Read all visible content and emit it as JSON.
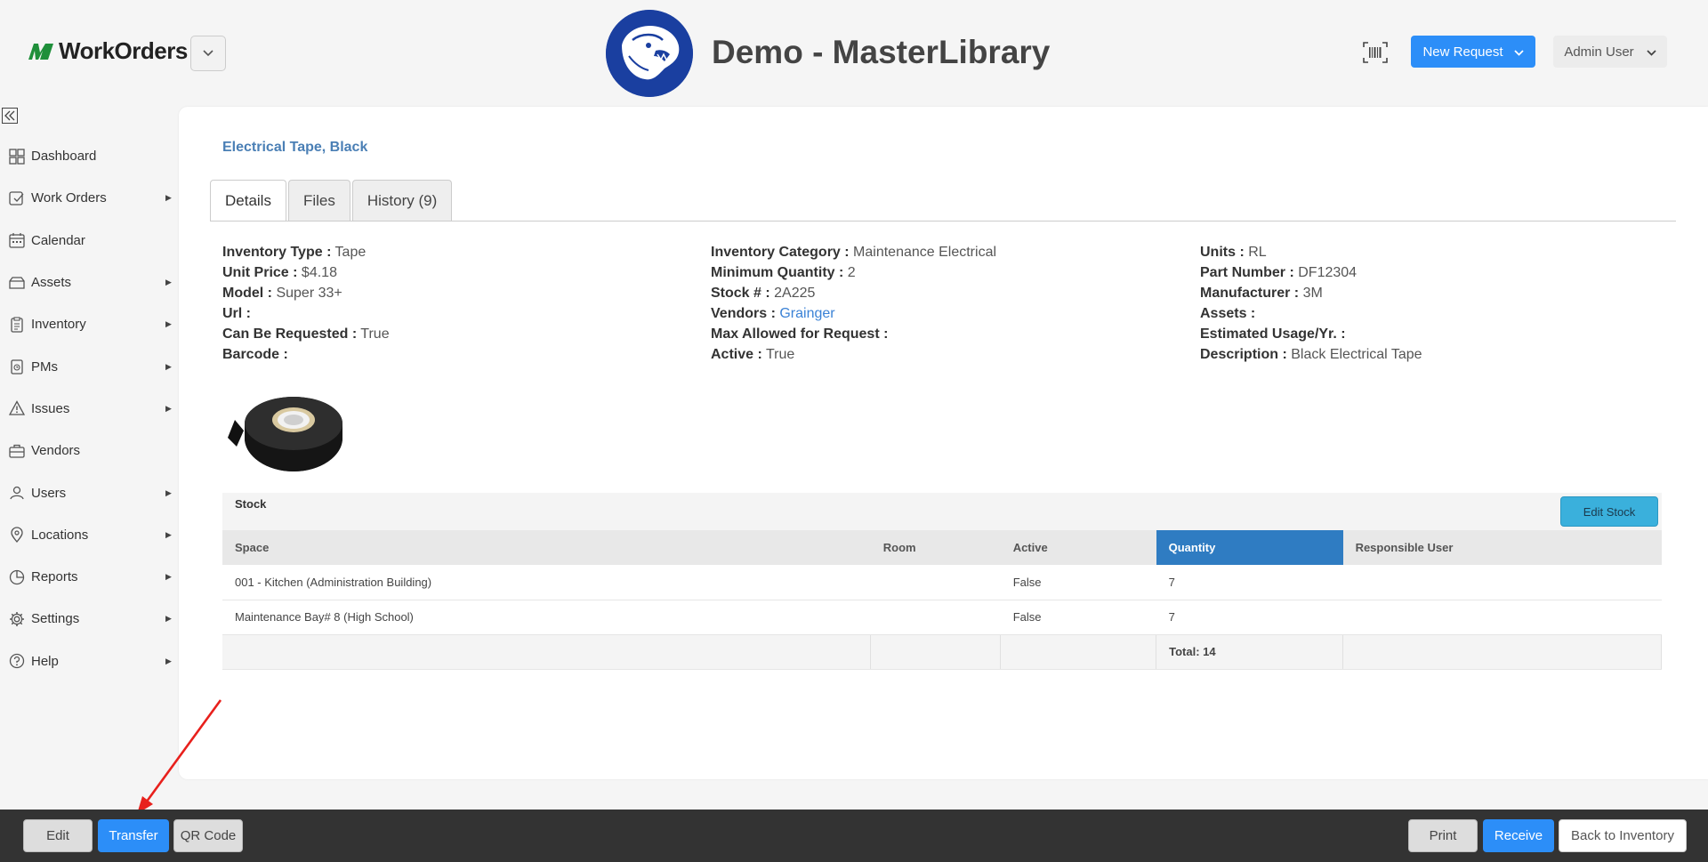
{
  "header": {
    "app_name": "WorkOrders",
    "org_title": "Demo - MasterLibrary",
    "new_request_label": "New Request",
    "user_label": "Admin User"
  },
  "sidebar": {
    "items": [
      {
        "label": "Dashboard",
        "icon": "dashboard-icon",
        "has_sub": false
      },
      {
        "label": "Work Orders",
        "icon": "work-orders-icon",
        "has_sub": true
      },
      {
        "label": "Calendar",
        "icon": "calendar-icon",
        "has_sub": false
      },
      {
        "label": "Assets",
        "icon": "assets-icon",
        "has_sub": true
      },
      {
        "label": "Inventory",
        "icon": "inventory-icon",
        "has_sub": true
      },
      {
        "label": "PMs",
        "icon": "pms-icon",
        "has_sub": true
      },
      {
        "label": "Issues",
        "icon": "warning-icon",
        "has_sub": true
      },
      {
        "label": "Vendors",
        "icon": "briefcase-icon",
        "has_sub": false
      },
      {
        "label": "Users",
        "icon": "users-icon",
        "has_sub": true
      },
      {
        "label": "Locations",
        "icon": "location-pin-icon",
        "has_sub": true
      },
      {
        "label": "Reports",
        "icon": "reports-icon",
        "has_sub": true
      },
      {
        "label": "Settings",
        "icon": "gear-icon",
        "has_sub": true
      },
      {
        "label": "Help",
        "icon": "help-icon",
        "has_sub": true
      }
    ]
  },
  "item": {
    "title": "Electrical Tape, Black"
  },
  "tabs": [
    "Details",
    "Files",
    "History (9)"
  ],
  "details": {
    "col1": [
      {
        "label": "Inventory Type :",
        "value": "Tape"
      },
      {
        "label": "Unit Price :",
        "value": "$4.18"
      },
      {
        "label": "Model :",
        "value": "Super 33+"
      },
      {
        "label": "Url :",
        "value": ""
      },
      {
        "label": "Can Be Requested :",
        "value": "True"
      },
      {
        "label": "Barcode :",
        "value": ""
      }
    ],
    "col2": [
      {
        "label": "Inventory Category :",
        "value": "Maintenance Electrical"
      },
      {
        "label": "Minimum Quantity :",
        "value": "2"
      },
      {
        "label": "Stock # :",
        "value": "2A225"
      },
      {
        "label": "Vendors :",
        "value": "Grainger"
      },
      {
        "label": "Max Allowed for Request :",
        "value": ""
      },
      {
        "label": "Active :",
        "value": "True"
      }
    ],
    "col3": [
      {
        "label": "Units :",
        "value": "RL"
      },
      {
        "label": "Part Number :",
        "value": "DF12304"
      },
      {
        "label": "Manufacturer :",
        "value": "3M"
      },
      {
        "label": "Assets :",
        "value": ""
      },
      {
        "label": "Estimated Usage/Yr. :",
        "value": ""
      },
      {
        "label": "Description :",
        "value": "Black Electrical Tape"
      }
    ]
  },
  "stock": {
    "label": "Stock",
    "edit_label": "Edit Stock",
    "columns": [
      "Space",
      "Room",
      "Active",
      "Quantity",
      "Responsible User"
    ],
    "rows": [
      {
        "space": "001 - Kitchen (Administration Building)",
        "room": "",
        "active": "False",
        "quantity": "7",
        "user": ""
      },
      {
        "space": "Maintenance Bay# 8 (High School)",
        "room": "",
        "active": "False",
        "quantity": "7",
        "user": ""
      }
    ],
    "total": "Total: 14"
  },
  "footer": {
    "edit": "Edit",
    "transfer": "Transfer",
    "qr_code": "QR Code",
    "print": "Print",
    "receive": "Receive",
    "back": "Back to Inventory"
  },
  "colors": {
    "accent": "#2c8ef8",
    "sorted_header": "#2f7cc2",
    "title_link": "#4a7fb5",
    "annotation": "#e8201c"
  }
}
